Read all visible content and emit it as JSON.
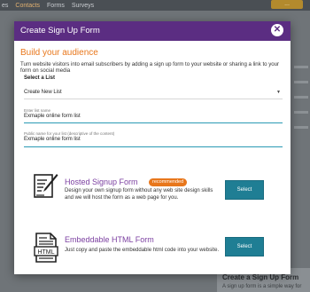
{
  "background": {
    "nav": [
      "es",
      "Contacts",
      "Forms",
      "Surveys"
    ],
    "button": "...",
    "right_title": "Create a Sign Up Form",
    "right_sub": "A sign up form is a simple way for"
  },
  "modal": {
    "title": "Create Sign Up Form",
    "close_icon": "close-icon",
    "heading": "Build your audience",
    "intro": "Turn website visitors into email subscribers by adding a sign up form to your website or sharing a link to your form on social media",
    "select_list_label": "Select a List",
    "list_dropdown": {
      "selected": "Create New List"
    },
    "list_name": {
      "label": "Enter list name",
      "value": "Exmaple online form list"
    },
    "public_name": {
      "label": "Public name for your list (descriptive of the content)",
      "value": "Exmaple online form list"
    },
    "options": [
      {
        "icon": "signup-form-icon",
        "title": "Hosted Signup Form",
        "badge": "recommended",
        "description": "Design your own signup form without any web site design skills and we will host the form as a web page for you.",
        "button": "Select"
      },
      {
        "icon": "html-file-icon",
        "title": "Embeddable HTML Form",
        "description": "Just copy and paste the embeddable html code into your website.",
        "button": "Select"
      }
    ]
  },
  "colors": {
    "header": "#5b2d82",
    "accent_orange": "#e8771c",
    "option_title": "#7b3fa0",
    "button": "#1f7e94",
    "field_underline": "#2a9ab5"
  }
}
